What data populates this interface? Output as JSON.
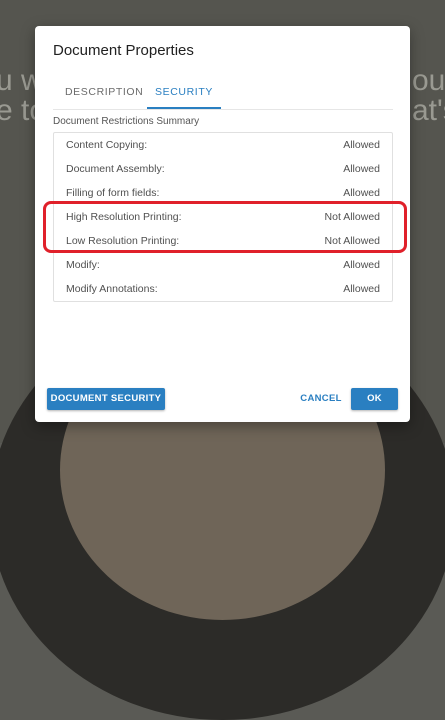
{
  "background": {
    "left_text_1": "u w",
    "left_text_2": "e to",
    "right_text_1": "ou",
    "right_text_2": "at's"
  },
  "dialog": {
    "title": "Document Properties",
    "tabs": [
      {
        "label": "DESCRIPTION",
        "active": false
      },
      {
        "label": "SECURITY",
        "active": true
      }
    ],
    "section_title": "Document Restrictions Summary",
    "rows": [
      {
        "label": "Content Copying:",
        "value": "Allowed"
      },
      {
        "label": "Document Assembly:",
        "value": "Allowed"
      },
      {
        "label": "Filling of form fields:",
        "value": "Allowed"
      },
      {
        "label": "High Resolution Printing:",
        "value": "Not Allowed"
      },
      {
        "label": "Low Resolution Printing:",
        "value": "Not Allowed"
      },
      {
        "label": "Modify:",
        "value": "Allowed"
      },
      {
        "label": "Modify Annotations:",
        "value": "Allowed"
      }
    ],
    "buttons": {
      "document_security": "DOCUMENT SECURITY",
      "cancel": "CANCEL",
      "ok": "OK"
    }
  },
  "colors": {
    "accent": "#2a7fc1",
    "highlight": "#e0202a"
  }
}
